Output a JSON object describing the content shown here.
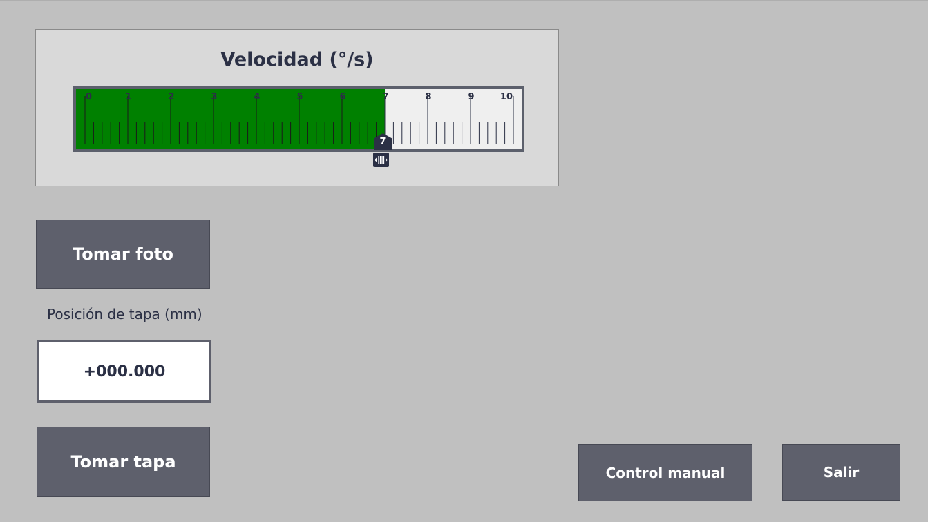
{
  "speed_slider": {
    "title": "Velocidad (°/s)",
    "min": 0,
    "max": 10,
    "value": 7,
    "value_label": "7",
    "tick_labels": [
      "0",
      "1",
      "2",
      "3",
      "4",
      "5",
      "6",
      "7",
      "8",
      "9",
      "10"
    ],
    "fill_color": "#008000",
    "track_color": "#efefef"
  },
  "buttons": {
    "take_photo": "Tomar foto",
    "take_lid": "Tomar tapa",
    "manual_control": "Control manual",
    "exit": "Salir"
  },
  "lid_position": {
    "label": "Posición de tapa (mm)",
    "value": "+000.000"
  },
  "colors": {
    "background": "#c0c0c0",
    "button": "#5e606c",
    "text_dark": "#2b3045"
  }
}
